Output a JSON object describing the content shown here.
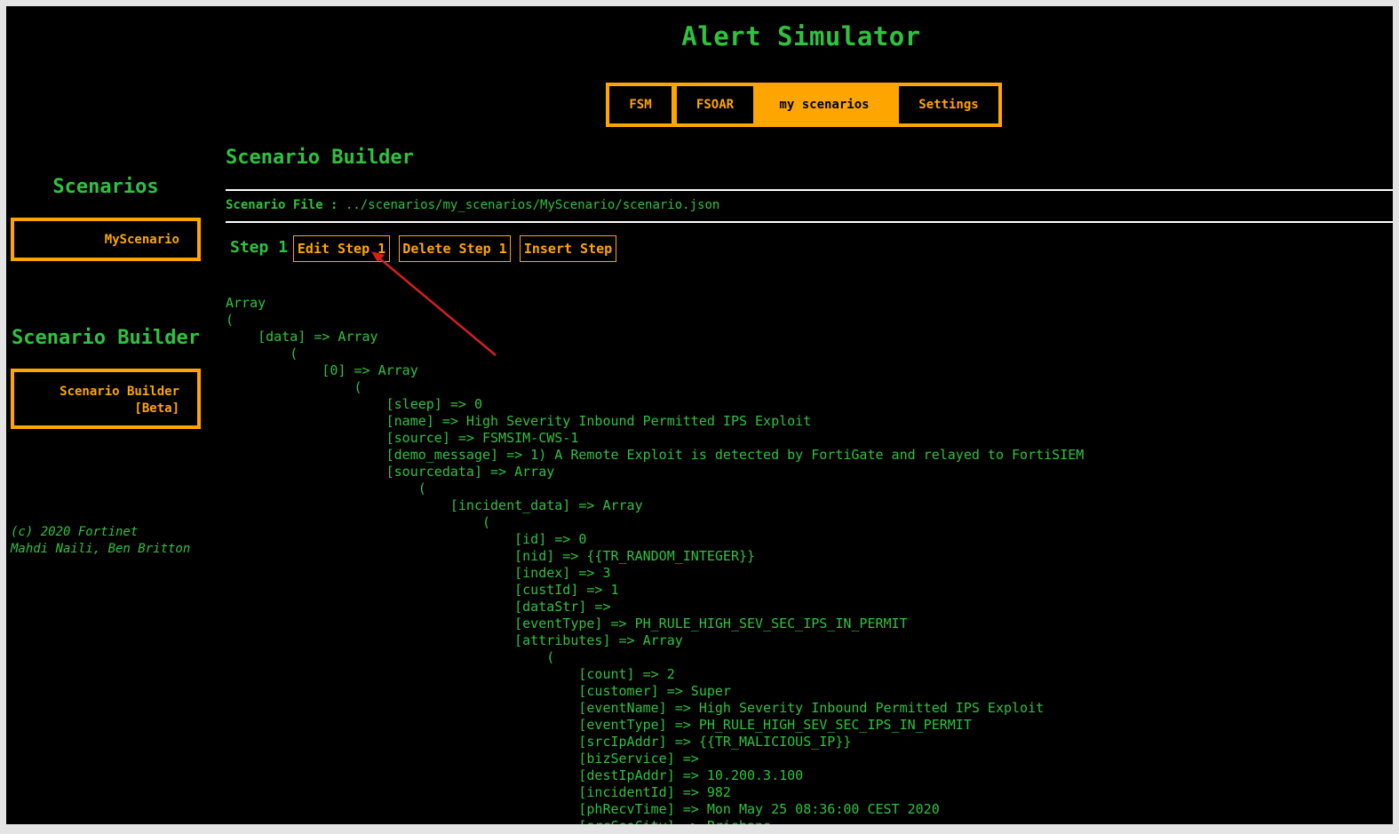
{
  "app_title": "Alert Simulator",
  "nav": {
    "tabs": [
      "FSM",
      "FSOAR",
      "my scenarios",
      "Settings"
    ],
    "active": "my scenarios"
  },
  "sidebar": {
    "scenarios_heading": "Scenarios",
    "scenario_item": "MyScenario",
    "builder_heading": "Scenario Builder",
    "builder_item_line1": "Scenario Builder",
    "builder_item_line2": "[Beta]",
    "footer_line1": "(c) 2020 Fortinet",
    "footer_line2": "Mahdi Naili, Ben Britton"
  },
  "main": {
    "title": "Scenario Builder",
    "file_label": "Scenario File :",
    "file_path": "../scenarios/my_scenarios/MyScenario/scenario.json",
    "step_label": "Step 1",
    "buttons": {
      "edit": "Edit Step 1",
      "delete": "Delete Step 1",
      "insert": "Insert Step"
    },
    "code_lines": [
      "Array",
      "(",
      "    [data] => Array",
      "        (",
      "            [0] => Array",
      "                (",
      "                    [sleep] => 0",
      "                    [name] => High Severity Inbound Permitted IPS Exploit",
      "                    [source] => FSMSIM-CWS-1",
      "                    [demo_message] => 1) A Remote Exploit is detected by FortiGate and relayed to FortiSIEM",
      "                    [sourcedata] => Array",
      "                        (",
      "                            [incident_data] => Array",
      "                                (",
      "                                    [id] => 0",
      "                                    [nid] => {{TR_RANDOM_INTEGER}}",
      "                                    [index] => 3",
      "                                    [custId] => 1",
      "                                    [dataStr] =>",
      "                                    [eventType] => PH_RULE_HIGH_SEV_SEC_IPS_IN_PERMIT",
      "                                    [attributes] => Array",
      "                                        (",
      "                                            [count] => 2",
      "                                            [customer] => Super",
      "                                            [eventName] => High Severity Inbound Permitted IPS Exploit",
      "                                            [eventType] => PH_RULE_HIGH_SEV_SEC_IPS_IN_PERMIT",
      "                                            [srcIpAddr] => {{TR_MALICIOUS_IP}}",
      "                                            [bizService] =>",
      "                                            [destIpAddr] => 10.200.3.100",
      "                                            [incidentId] => 982",
      "                                            [phRecvTime] => Mon May 25 08:36:00 CEST 2020",
      "                                            [srcGeoCity] => Brisbane"
    ]
  },
  "colors": {
    "accent": "#ffa500",
    "text": "#2fc23f",
    "background": "#000000",
    "annotation_arrow": "#d42020"
  }
}
